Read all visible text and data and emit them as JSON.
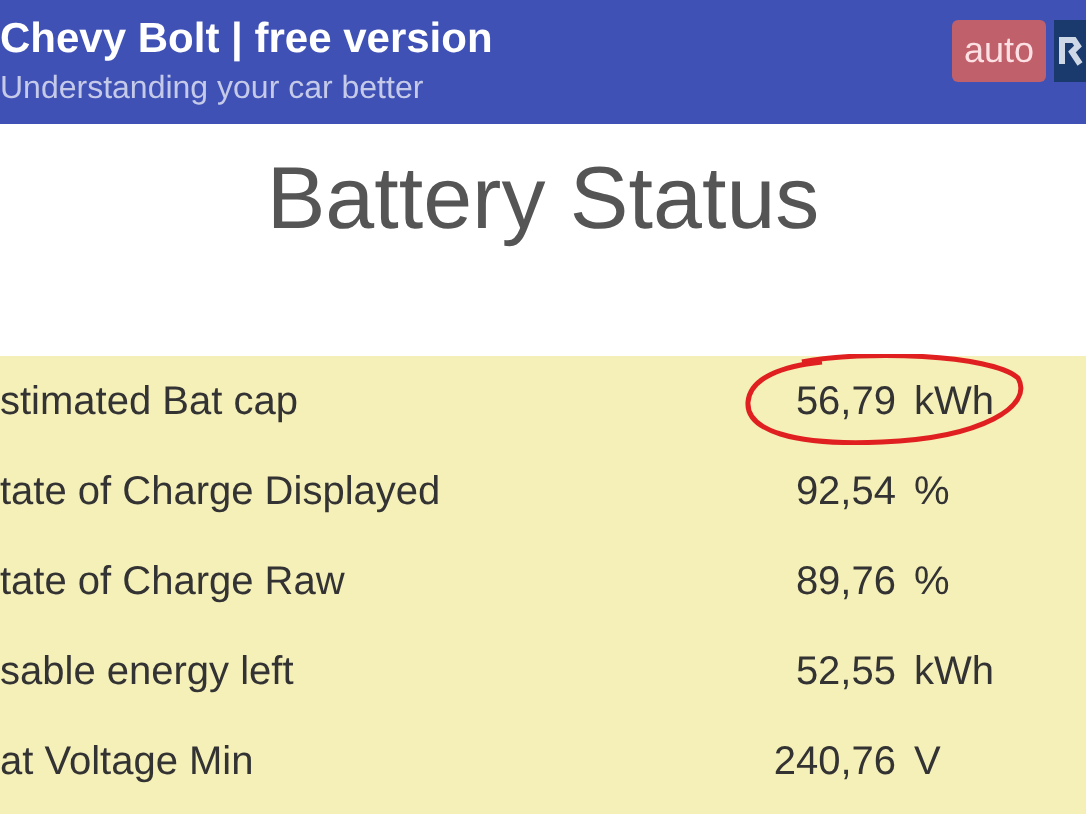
{
  "header": {
    "title": "Chevy Bolt | free version",
    "subtitle": "Understanding your car better",
    "logo": "auto"
  },
  "page_title": "Battery Status",
  "rows": [
    {
      "label": "stimated Bat cap",
      "value": "56,79",
      "unit": "kWh",
      "circled": true
    },
    {
      "label": "tate of Charge Displayed",
      "value": "92,54",
      "unit": "%",
      "circled": false
    },
    {
      "label": "tate of Charge Raw",
      "value": "89,76",
      "unit": "%",
      "circled": false
    },
    {
      "label": "sable energy left",
      "value": "52,55",
      "unit": "kWh",
      "circled": false
    },
    {
      "label": "at Voltage Min",
      "value": "240,76",
      "unit": "V",
      "circled": false
    }
  ]
}
